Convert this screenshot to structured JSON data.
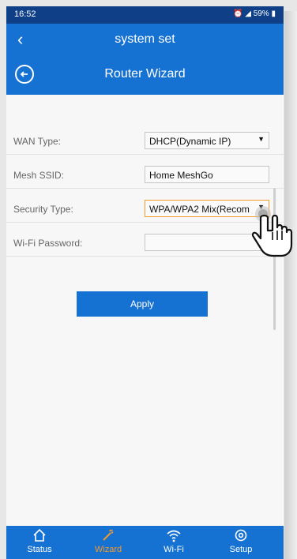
{
  "status_bar": {
    "time": "16:52",
    "battery": "59%"
  },
  "header": {
    "app_title": "system set",
    "page_title": "Router Wizard"
  },
  "form": {
    "wan_type_label": "WAN Type:",
    "wan_type_value": "DHCP(Dynamic IP)",
    "mesh_ssid_label": "Mesh SSID:",
    "mesh_ssid_value": "Home MeshGo",
    "security_type_label": "Security Type:",
    "security_type_value": "WPA/WPA2 Mix(Recom",
    "wifi_password_label": "Wi-Fi Password:",
    "wifi_password_value": ""
  },
  "apply_label": "Apply",
  "bottom_nav": {
    "items": [
      {
        "label": "Status",
        "icon": "home-icon"
      },
      {
        "label": "Wizard",
        "icon": "wand-icon"
      },
      {
        "label": "Wi-Fi",
        "icon": "wifi-icon"
      },
      {
        "label": "Setup",
        "icon": "gear-icon"
      }
    ],
    "active": "Wizard"
  },
  "colors": {
    "primary": "#1572d3",
    "status_bar": "#0e3f87",
    "accent": "#f39a2c"
  }
}
